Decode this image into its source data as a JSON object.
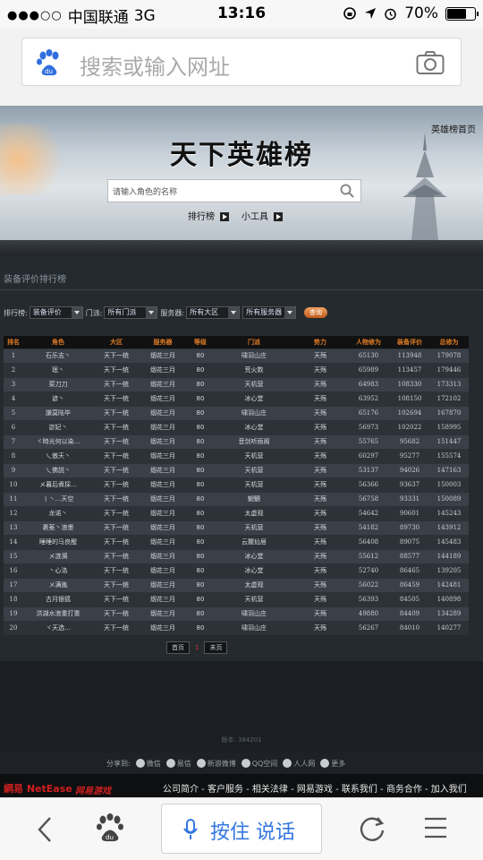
{
  "status_bar": {
    "signal_dots": "●●●○○",
    "carrier": "中国联通",
    "network": "3G",
    "time": "13:16",
    "battery": "70%",
    "battery_level": 0.7
  },
  "browser": {
    "search_placeholder": "搜索或输入网址",
    "voice_label": "按住 说话"
  },
  "banner": {
    "home_link": "英雄榜首页",
    "title": "天下英雄榜",
    "search_placeholder": "请输入角色的名称",
    "links": [
      "排行榜",
      "小工具"
    ]
  },
  "section": {
    "title": "装备评价排行榜"
  },
  "filters": {
    "rank_label": "排行榜:",
    "rank_value": "装备评价",
    "sect_label": "门派:",
    "sect_value": "所有门派",
    "server_label": "服务器:",
    "region_value": "所有大区",
    "server_value": "所有服务器",
    "query_button": "查询"
  },
  "table": {
    "headers": [
      "排名",
      "角色",
      "大区",
      "服务器",
      "等级",
      "门派",
      "势力",
      "人物修为",
      "装备评价",
      "总修为"
    ],
    "rows": [
      [
        "1",
        "石乐志丶",
        "天下一统",
        "烟花三月",
        "80",
        "啸羽山庄",
        "天殇",
        "65130",
        "113948",
        "179078"
      ],
      [
        "2",
        "珉丶",
        "天下一统",
        "烟花三月",
        "80",
        "荒火数",
        "天殇",
        "65989",
        "113457",
        "179446"
      ],
      [
        "3",
        "菜刀刀",
        "天下一统",
        "烟花三月",
        "80",
        "天机营",
        "天殇",
        "64983",
        "108330",
        "173313"
      ],
      [
        "4",
        "谚丶",
        "天下一统",
        "烟花三月",
        "80",
        "冰心堂",
        "天殇",
        "63952",
        "108150",
        "172102"
      ],
      [
        "5",
        "謙莫陆毕",
        "天下一统",
        "烟花三月",
        "80",
        "啸羽山庄",
        "天殇",
        "65176",
        "102694",
        "167870"
      ],
      [
        "6",
        "宓妃丶",
        "天下一统",
        "烟花三月",
        "80",
        "冰心堂",
        "天殇",
        "56973",
        "102022",
        "158995"
      ],
      [
        "7",
        "ヾ時光何以染...",
        "天下一统",
        "烟花三月",
        "80",
        "音剑听雨阁",
        "天殇",
        "55765",
        "95682",
        "151447"
      ],
      [
        "8",
        "乀傲天丶",
        "天下一统",
        "烟花三月",
        "80",
        "天机营",
        "天殇",
        "60297",
        "95277",
        "155574"
      ],
      [
        "9",
        "乀佛説丶",
        "天下一统",
        "烟花三月",
        "80",
        "天机营",
        "天殇",
        "53137",
        "94026",
        "147163"
      ],
      [
        "10",
        "メ暮后煮採...",
        "天下一统",
        "烟花三月",
        "80",
        "天机营",
        "天殇",
        "56366",
        "93637",
        "150003"
      ],
      [
        "11",
        "丨丶...天空",
        "天下一统",
        "烟花三月",
        "80",
        "魍魉",
        "天殇",
        "56758",
        "93331",
        "150089"
      ],
      [
        "12",
        "龙诺丶",
        "天下一统",
        "烟花三月",
        "80",
        "太虚观",
        "天殇",
        "54642",
        "90601",
        "145243"
      ],
      [
        "13",
        "裹莬丶浪墨",
        "天下一统",
        "烟花三月",
        "80",
        "天机营",
        "天殇",
        "54182",
        "89730",
        "143912"
      ],
      [
        "14",
        "睡睡的马良醒",
        "天下一统",
        "烟花三月",
        "80",
        "云麓仙居",
        "天殇",
        "56408",
        "89075",
        "145483"
      ],
      [
        "15",
        "メ涟漪",
        "天下一统",
        "烟花三月",
        "80",
        "冰心堂",
        "天殇",
        "55612",
        "88577",
        "144189"
      ],
      [
        "16",
        "丶心洛",
        "天下一统",
        "烟花三月",
        "80",
        "冰心堂",
        "天殇",
        "52740",
        "86465",
        "139205"
      ],
      [
        "17",
        "メ满胤",
        "天下一统",
        "烟花三月",
        "80",
        "太虚观",
        "天殇",
        "56022",
        "86459",
        "142481"
      ],
      [
        "18",
        "古月银狐",
        "天下一统",
        "烟花三月",
        "80",
        "天机营",
        "天殇",
        "56393",
        "84505",
        "140898"
      ],
      [
        "19",
        "洪湖水浪重打重",
        "天下一统",
        "烟花三月",
        "80",
        "啸羽山庄",
        "天殇",
        "49880",
        "84409",
        "134289"
      ],
      [
        "20",
        "ヾ天选...",
        "天下一统",
        "烟花三月",
        "80",
        "啸羽山庄",
        "天殇",
        "56267",
        "84010",
        "140277"
      ]
    ]
  },
  "pager": {
    "first": "首页",
    "current": "1",
    "last": "末页"
  },
  "version_text": "版本: 384201",
  "share": {
    "label": "分享到:",
    "items": [
      "微信",
      "易信",
      "新浪微博",
      "QQ空间",
      "人人网",
      "更多"
    ]
  },
  "footer": {
    "logo_netease": "網易 NetEase",
    "logo_game": "网易游戏",
    "links": "公司简介 - 客户服务 - 相关法律 - 网易游戏 - 联系我们 - 商务合作 - 加入我们"
  }
}
